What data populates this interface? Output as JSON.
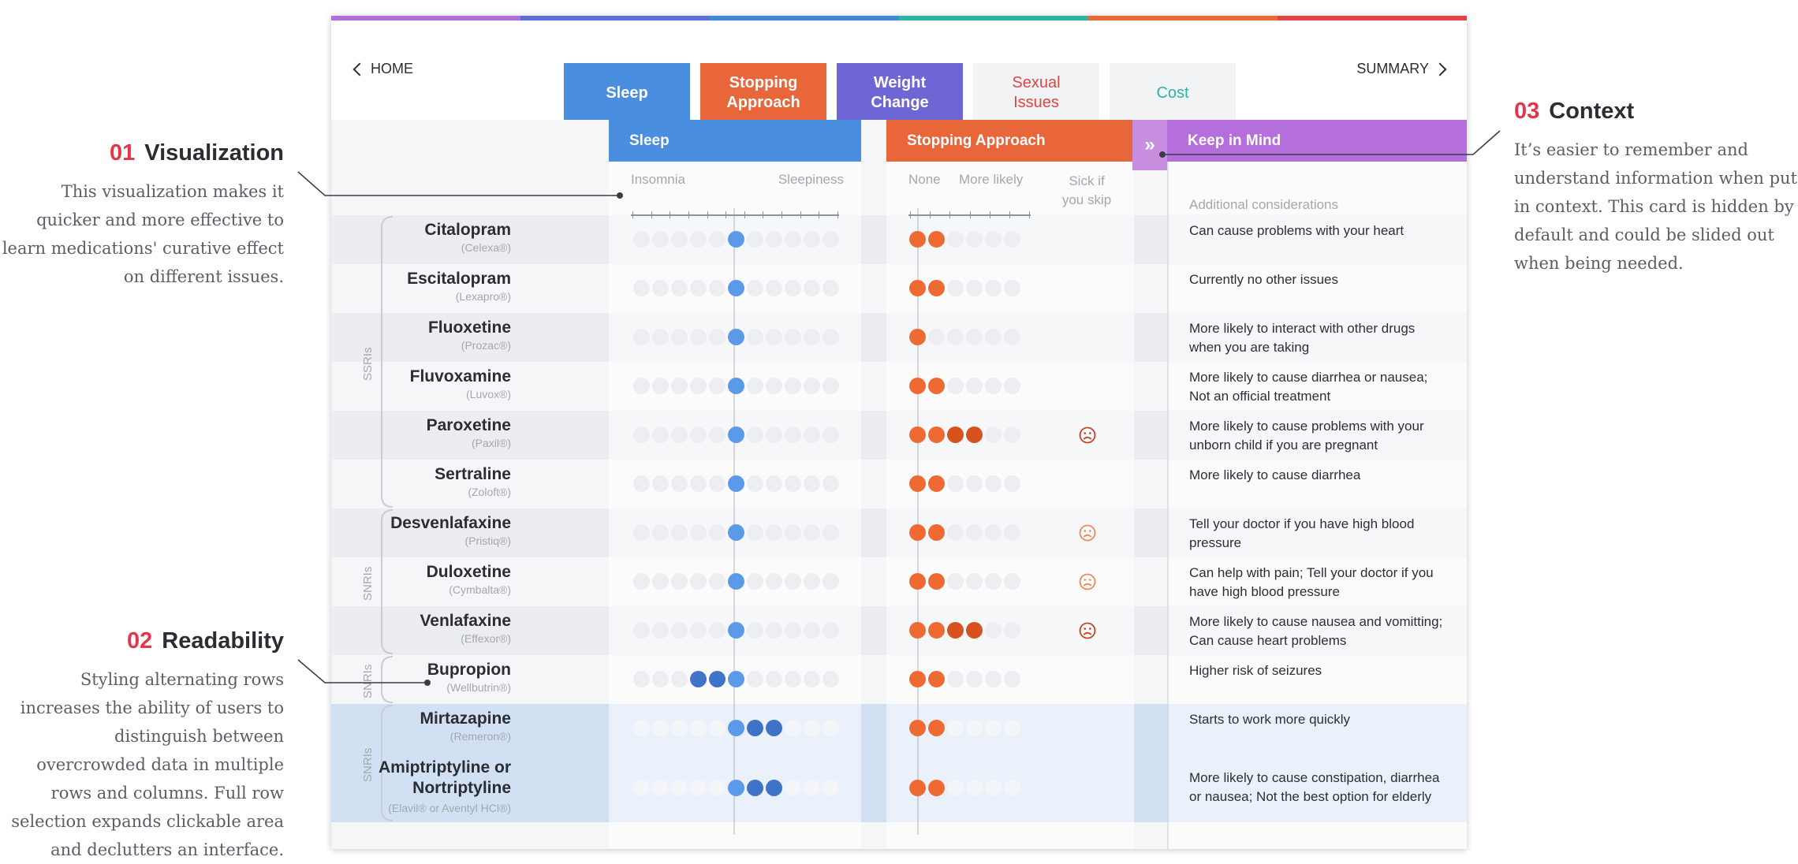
{
  "annotations": [
    {
      "num": "01",
      "title": "Visualization",
      "text": "This visualization makes it quicker and more effective to learn medications' curative effect on different issues."
    },
    {
      "num": "02",
      "title": "Readability",
      "text": "Styling alternating rows increases the ability of users to distinguish between overcrowded data in multiple rows and columns. Full row selection expands clickable area and declutters an interface."
    },
    {
      "num": "03",
      "title": "Context",
      "text": "It’s easier to remember and understand information when put in context. This card is hidden by default and could be slided out when being needed."
    }
  ],
  "stripe_colors": [
    "#b06fdc",
    "#5b6fd6",
    "#3f8ad8",
    "#2fb3a2",
    "#e86a36",
    "#e04545"
  ],
  "nav": {
    "home": "HOME",
    "summary": "SUMMARY"
  },
  "tabs": [
    {
      "label": "Sleep",
      "bg": "#4a8edf",
      "selected": true
    },
    {
      "label": "Stopping\nApproach",
      "bg": "#e8663a",
      "selected": true
    },
    {
      "label": "Weight\nChange",
      "bg": "#6f66d6",
      "selected": true
    },
    {
      "label": "Sexual\nIssues",
      "color": "#e04545",
      "selected": false
    },
    {
      "label": "Cost",
      "color": "#2fb3a2",
      "selected": false
    }
  ],
  "columns": {
    "sleep": {
      "title": "Sleep",
      "color": "#4a8edf",
      "left": "Insomnia",
      "right": "Sleepiness"
    },
    "stopping": {
      "title": "Stopping Approach",
      "color": "#e8663a",
      "none": "None",
      "more": "More likely",
      "sick": "Sick if\nyou skip"
    },
    "keep": {
      "title": "Keep in Mind",
      "color": "#b56fdc",
      "sub": "Additional considerations"
    }
  },
  "groups": [
    "SSRIs",
    "SNRIs",
    "SNRIs",
    "SNRIs"
  ],
  "colors": {
    "blue": "#5a9ae8",
    "blue_dark": "#3f73c8",
    "orange": "#ef6a33",
    "orange_dark": "#d9511e",
    "dot_empty": "#eceef1",
    "face_dark": "#c44424",
    "face_light": "#ee8a5a"
  },
  "rows": [
    {
      "name": "Citalopram",
      "brand": "(Celexa®)",
      "sleep": [
        5
      ],
      "stop": 2,
      "stopDark": 0,
      "face": "",
      "note": "Can cause problems with your heart"
    },
    {
      "name": "Escitalopram",
      "brand": "(Lexapro®)",
      "sleep": [
        5
      ],
      "stop": 2,
      "stopDark": 0,
      "face": "",
      "note": "Currently no other issues"
    },
    {
      "name": "Fluoxetine",
      "brand": "(Prozac®)",
      "sleep": [
        5
      ],
      "stop": 1,
      "stopDark": 0,
      "face": "",
      "note": "More likely to interact with other drugs when you are taking"
    },
    {
      "name": "Fluvoxamine",
      "brand": "(Luvox®)",
      "sleep": [
        5
      ],
      "stop": 2,
      "stopDark": 0,
      "face": "",
      "note": "More likely to cause diarrhea or nausea; Not an official treatment"
    },
    {
      "name": "Paroxetine",
      "brand": "(Paxil®)",
      "sleep": [
        5
      ],
      "stop": 2,
      "stopDark": 2,
      "face": "dark",
      "note": "More likely to cause problems with your unborn child if you are pregnant"
    },
    {
      "name": "Sertraline",
      "brand": "(Zoloft®)",
      "sleep": [
        5
      ],
      "stop": 2,
      "stopDark": 0,
      "face": "",
      "note": "More likely to cause diarrhea"
    },
    {
      "name": "Desvenlafaxine",
      "brand": "(Pristiq®)",
      "sleep": [
        5
      ],
      "stop": 2,
      "stopDark": 0,
      "face": "light",
      "note": "Tell your doctor if you have high blood pressure"
    },
    {
      "name": "Duloxetine",
      "brand": "(Cymbalta®)",
      "sleep": [
        5
      ],
      "stop": 2,
      "stopDark": 0,
      "face": "light",
      "note": "Can help with pain; Tell your doctor if you have high blood pressure"
    },
    {
      "name": "Venlafaxine",
      "brand": "(Effexor®)",
      "sleep": [
        5
      ],
      "stop": 2,
      "stopDark": 2,
      "face": "dark",
      "note": "More likely to cause nausea and vomitting; Can cause heart problems"
    },
    {
      "name": "Bupropion",
      "brand": "(Wellbutrin®)",
      "sleep": [
        3,
        4,
        5
      ],
      "stop": 2,
      "stopDark": 0,
      "face": "",
      "note": "Higher risk of seizures"
    },
    {
      "name": "Mirtazapine",
      "brand": "(Remeron®)",
      "sleep": [
        5,
        6,
        7
      ],
      "stop": 2,
      "stopDark": 0,
      "face": "",
      "note": "Starts to work more quickly"
    },
    {
      "name": "Amiptriptyline or\nNortriptyline",
      "brand": "(Elavil® or Aventyl HCl®)",
      "sleep": [
        5,
        6,
        7
      ],
      "stop": 2,
      "stopDark": 0,
      "face": "",
      "note": "More likely to cause constipation, diarrhea or nausea; Not the best option for elderly"
    }
  ]
}
